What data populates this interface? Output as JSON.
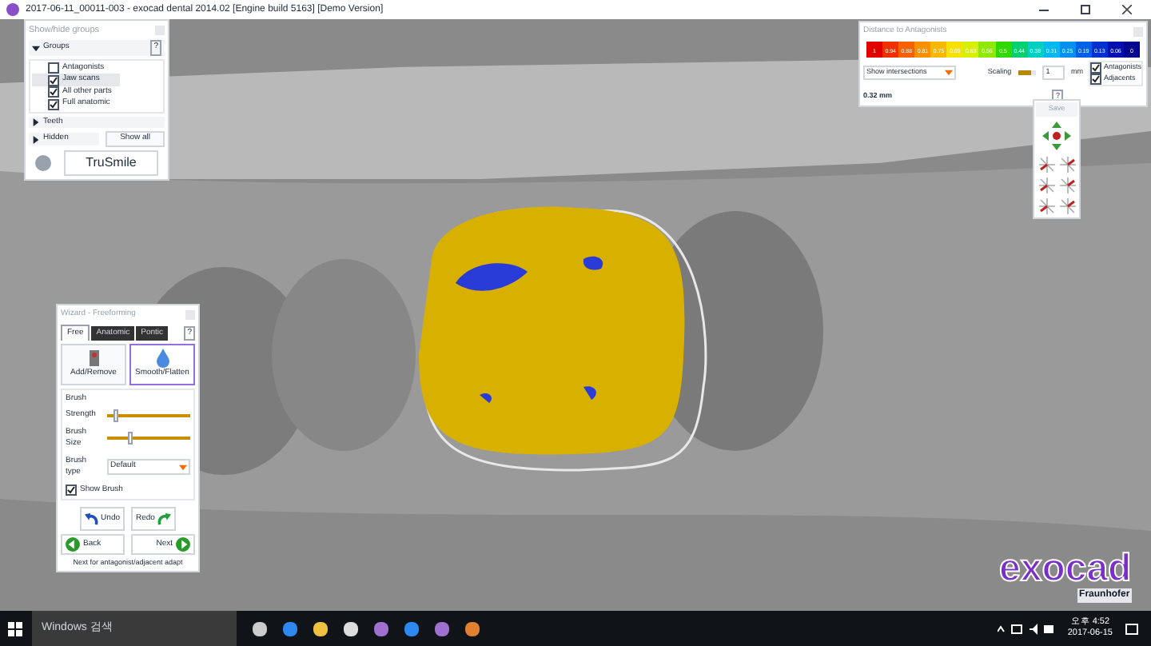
{
  "window": {
    "title": "2017-06-11_00011-003 - exocad dental 2014.02 [Engine build 5163] [Demo Version]"
  },
  "groups_panel": {
    "title": "Show/hide groups",
    "groups_header": "Groups",
    "help": "?",
    "groups": [
      {
        "label": "Antagonists",
        "checked": false,
        "selected": false
      },
      {
        "label": "Jaw scans",
        "checked": true,
        "selected": true
      },
      {
        "label": "All other parts",
        "checked": true,
        "selected": false
      },
      {
        "label": "Full anatomic",
        "checked": true,
        "selected": false
      }
    ],
    "teeth_header": "Teeth",
    "hidden_header": "Hidden",
    "show_all": "Show all",
    "brand_button": "TruSmile"
  },
  "distance_panel": {
    "title": "Distance to Antagonists",
    "scale_labels": [
      "1",
      "0.94",
      "0.88",
      "0.81",
      "0.75",
      "0.69",
      "0.63",
      "0.56",
      "0.5",
      "0.44",
      "0.38",
      "0.31",
      "0.25",
      "0.19",
      "0.13",
      "0.06",
      "0"
    ],
    "mode": "Show intersections",
    "scaling_label": "Scaling",
    "scaling": {
      "level": 0.7
    },
    "scaling_value": "1",
    "unit": "mm",
    "reading": "0.32 mm",
    "help": "?",
    "targets": [
      {
        "label": "Antagonists",
        "checked": true
      },
      {
        "label": "Adjacents",
        "checked": true
      }
    ]
  },
  "nav_toolbar": {
    "save": "Save"
  },
  "wizard": {
    "title": "Wizard - Freeforming",
    "help": "?",
    "tabs": [
      {
        "label": "Free",
        "selected": true
      },
      {
        "label": "Anatomic",
        "selected": false
      },
      {
        "label": "Pontic",
        "selected": false
      }
    ],
    "tools": [
      {
        "label": "Add/Remove",
        "selected": false
      },
      {
        "label": "Smooth/Flatten",
        "selected": true
      }
    ],
    "brush_header": "Brush",
    "sliders": [
      {
        "label": "Strength",
        "level": 0.08
      },
      {
        "label": "Brush Size",
        "level": 0.25
      }
    ],
    "brush_type_label": "Brush type",
    "brush_type": "Default",
    "show_brush": {
      "label": "Show Brush",
      "checked": true
    },
    "undo": "Undo",
    "redo": "Redo",
    "back": "Back",
    "next": "Next",
    "hint": "Next for antagonist/adjacent adapt"
  },
  "logo": {
    "name": "exocad",
    "partner": "Fraunhofer"
  },
  "taskbar": {
    "search_placeholder": "Windows 검색",
    "time": "오후 4:52",
    "date": "2017-06-15"
  }
}
